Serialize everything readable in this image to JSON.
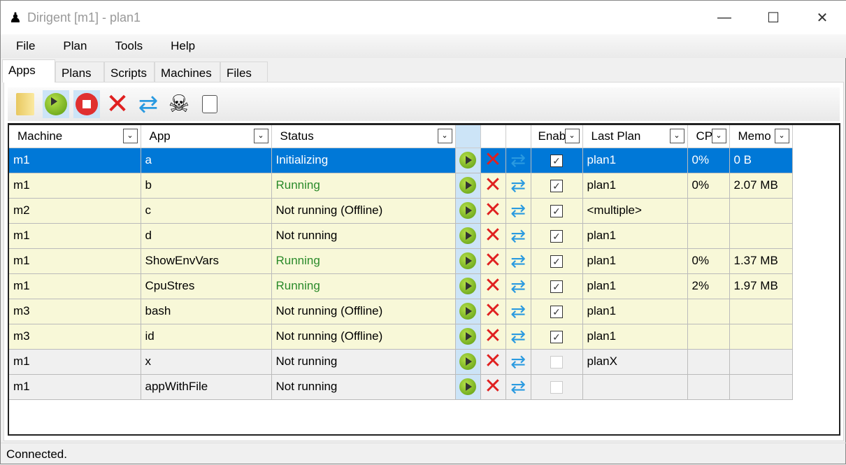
{
  "window": {
    "title": "Dirigent [m1] - plan1",
    "minimize": "—",
    "maximize": "☐",
    "close": "✕"
  },
  "menu": [
    "File",
    "Plan",
    "Tools",
    "Help"
  ],
  "tabs": [
    "Apps",
    "Plans",
    "Scripts",
    "Machines",
    "Files"
  ],
  "toolbar": [
    "folder-icon",
    "play-icon",
    "stop-icon",
    "kill-icon",
    "restart-icon",
    "skull-icon",
    "log-icon"
  ],
  "columns": [
    "Machine",
    "App",
    "Status",
    "",
    "",
    "",
    "Enabled",
    "Last Plan",
    "CPU",
    "Memory"
  ],
  "columns_visible": [
    "Machine",
    "App",
    "Status",
    "",
    "",
    "",
    "Enab",
    "Last Plan",
    "CP",
    "Memo"
  ],
  "rows": [
    {
      "machine": "m1",
      "app": "a",
      "status": "Initializing",
      "enabled": true,
      "plan": "plan1",
      "cpu": "0%",
      "mem": "0 B",
      "style": "s",
      "sc": "st-init"
    },
    {
      "machine": "m1",
      "app": "b",
      "status": "Running",
      "enabled": true,
      "plan": "plan1",
      "cpu": "0%",
      "mem": "2.07 MB",
      "style": "y",
      "sc": "st-run"
    },
    {
      "machine": "m2",
      "app": "c",
      "status": "Not running (Offline)",
      "enabled": true,
      "plan": "<multiple>",
      "cpu": "",
      "mem": "",
      "style": "y",
      "sc": ""
    },
    {
      "machine": "m1",
      "app": "d",
      "status": "Not running",
      "enabled": true,
      "plan": "plan1",
      "cpu": "",
      "mem": "",
      "style": "y",
      "sc": ""
    },
    {
      "machine": "m1",
      "app": "ShowEnvVars",
      "status": "Running",
      "enabled": true,
      "plan": "plan1",
      "cpu": "0%",
      "mem": "1.37 MB",
      "style": "y",
      "sc": "st-run"
    },
    {
      "machine": "m1",
      "app": "CpuStres",
      "status": "Running",
      "enabled": true,
      "plan": "plan1",
      "cpu": "2%",
      "mem": "1.97 MB",
      "style": "y",
      "sc": "st-run"
    },
    {
      "machine": "m3",
      "app": "bash",
      "status": "Not running (Offline)",
      "enabled": true,
      "plan": "plan1",
      "cpu": "",
      "mem": "",
      "style": "y",
      "sc": ""
    },
    {
      "machine": "m3",
      "app": "id",
      "status": "Not running (Offline)",
      "enabled": true,
      "plan": "plan1",
      "cpu": "",
      "mem": "",
      "style": "y",
      "sc": ""
    },
    {
      "machine": "m1",
      "app": "x",
      "status": "Not running",
      "enabled": false,
      "plan": "planX",
      "cpu": "",
      "mem": "",
      "style": "g",
      "sc": ""
    },
    {
      "machine": "m1",
      "app": "appWithFile",
      "status": "Not running",
      "enabled": false,
      "plan": "",
      "cpu": "",
      "mem": "",
      "style": "g",
      "sc": ""
    }
  ],
  "status_bar": "Connected."
}
